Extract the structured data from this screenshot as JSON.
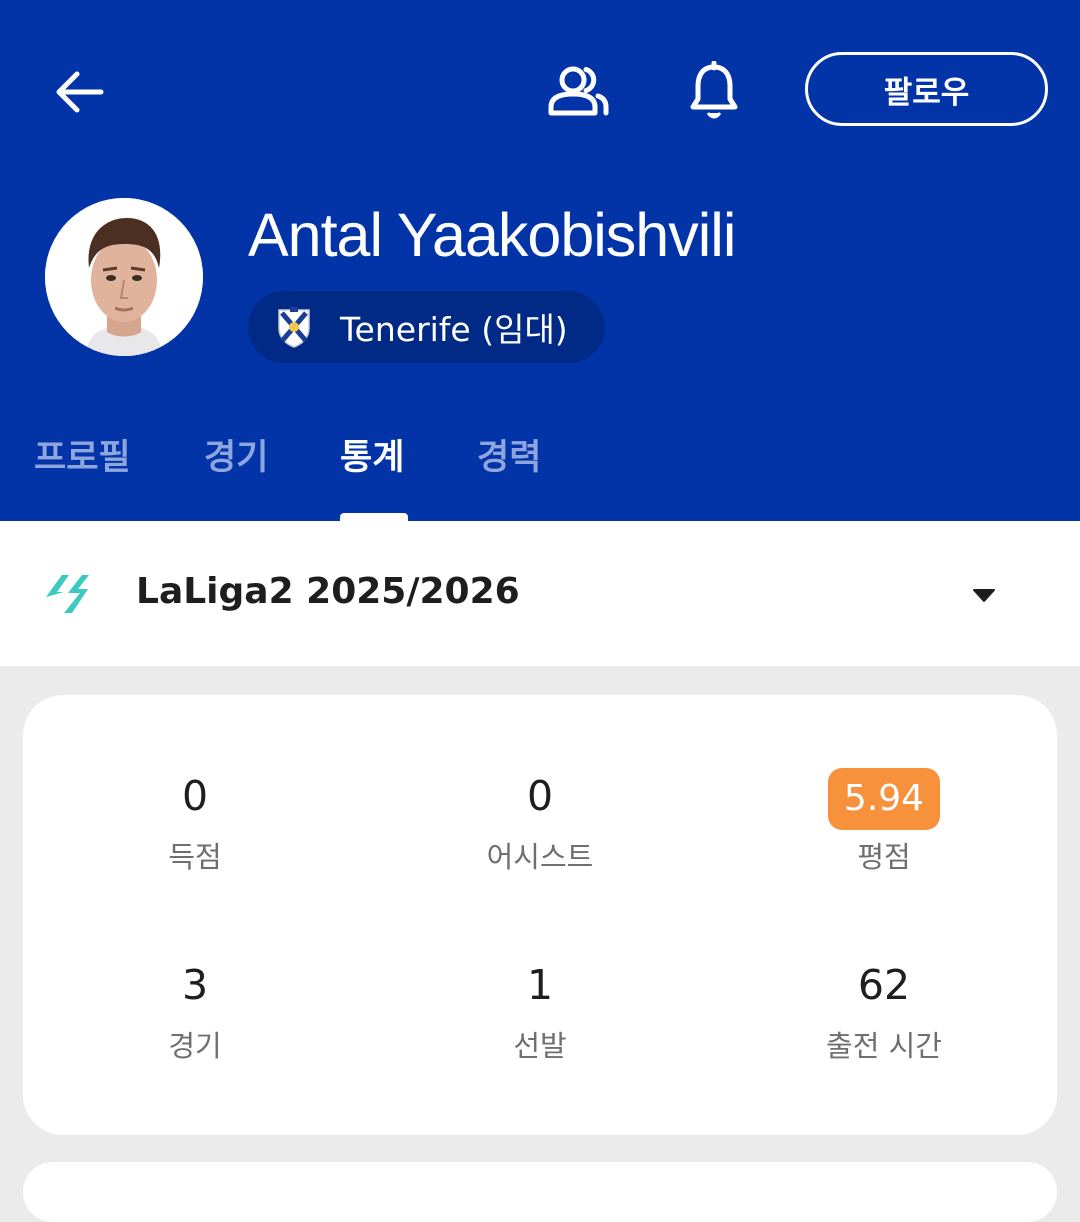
{
  "header": {
    "follow_label": "팔로우",
    "player_name": "Antal Yaakobishvili",
    "team_name": "Tenerife (임대)",
    "icons": [
      "arrow-left-icon",
      "people-icon",
      "bell-icon"
    ],
    "background_color": "#0234a8"
  },
  "tabs": [
    {
      "label": "프로필",
      "active": false
    },
    {
      "label": "경기",
      "active": false
    },
    {
      "label": "통계",
      "active": true
    },
    {
      "label": "경력",
      "active": false
    }
  ],
  "league": {
    "name": "LaLiga2 2025/2026",
    "icon": "laliga-logo-icon",
    "accent_color": "#3cc9bf"
  },
  "stats": [
    {
      "value": "0",
      "label": "득점"
    },
    {
      "value": "0",
      "label": "어시스트"
    },
    {
      "value": "5.94",
      "label": "평점",
      "badge_color": "#f7913b"
    },
    {
      "value": "3",
      "label": "경기"
    },
    {
      "value": "1",
      "label": "선발"
    },
    {
      "value": "62",
      "label": "출전 시간"
    }
  ]
}
